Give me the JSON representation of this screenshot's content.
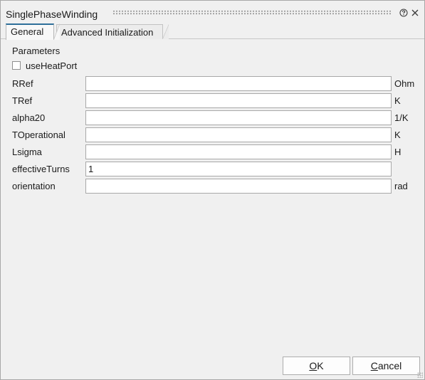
{
  "window": {
    "title": "SinglePhaseWinding"
  },
  "titlebar": {
    "help_icon": "question-circle-icon",
    "close_icon": "close-icon"
  },
  "tabs": [
    {
      "label": "General",
      "active": true
    },
    {
      "label": "Advanced Initialization",
      "active": false
    }
  ],
  "general": {
    "section_label": "Parameters",
    "use_heat_port": {
      "label": "useHeatPort",
      "checked": false
    },
    "params": [
      {
        "name": "RRef",
        "value": "",
        "unit": "Ohm"
      },
      {
        "name": "TRef",
        "value": "",
        "unit": "K"
      },
      {
        "name": "alpha20",
        "value": "",
        "unit": "1/K"
      },
      {
        "name": "TOperational",
        "value": "",
        "unit": "K"
      },
      {
        "name": "Lsigma",
        "value": "",
        "unit": "H"
      },
      {
        "name": "effectiveTurns",
        "value": "1",
        "unit": ""
      },
      {
        "name": "orientation",
        "value": "",
        "unit": "rad"
      }
    ]
  },
  "buttons": {
    "ok_mnemonic": "O",
    "ok_rest": "K",
    "cancel_mnemonic": "C",
    "cancel_rest": "ancel"
  },
  "colors": {
    "active_tab_accent": "#2e6f9a",
    "dialog_background": "#f0f0f0"
  }
}
